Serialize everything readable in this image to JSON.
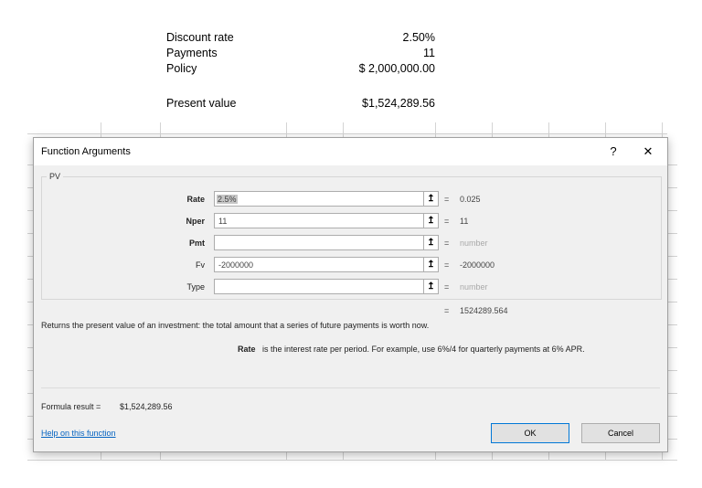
{
  "sheet": {
    "rows": [
      {
        "label": "Discount rate",
        "value": "2.50%"
      },
      {
        "label": "Payments",
        "value": "11"
      },
      {
        "label": "Policy",
        "value": "$ 2,000,000.00"
      },
      {
        "label": "Present value",
        "value": "$1,524,289.56"
      }
    ]
  },
  "dialog": {
    "title": "Function Arguments",
    "help_glyph": "?",
    "close_glyph": "✕",
    "function_name": "PV",
    "ref_glyph": "↥",
    "equals": "=",
    "args": [
      {
        "label": "Rate",
        "value": "2.5%",
        "result": "0.025"
      },
      {
        "label": "Nper",
        "value": "11",
        "result": "11"
      },
      {
        "label": "Pmt",
        "value": "",
        "result": "number"
      },
      {
        "label": "Fv",
        "value": "-2000000",
        "result": "-2000000"
      },
      {
        "label": "Type",
        "value": "",
        "result": "number"
      }
    ],
    "function_result": "1524289.564",
    "description": "Returns the present value of an investment: the total amount that a series of future payments is worth now.",
    "arg_help_name": "Rate",
    "arg_help_text": "is the interest rate per period. For example, use 6%/4 for quarterly payments at 6% APR.",
    "formula_result_label": "Formula result =",
    "formula_result_value": "$1,524,289.56",
    "help_link": "Help on this function",
    "ok_label": "OK",
    "cancel_label": "Cancel"
  }
}
